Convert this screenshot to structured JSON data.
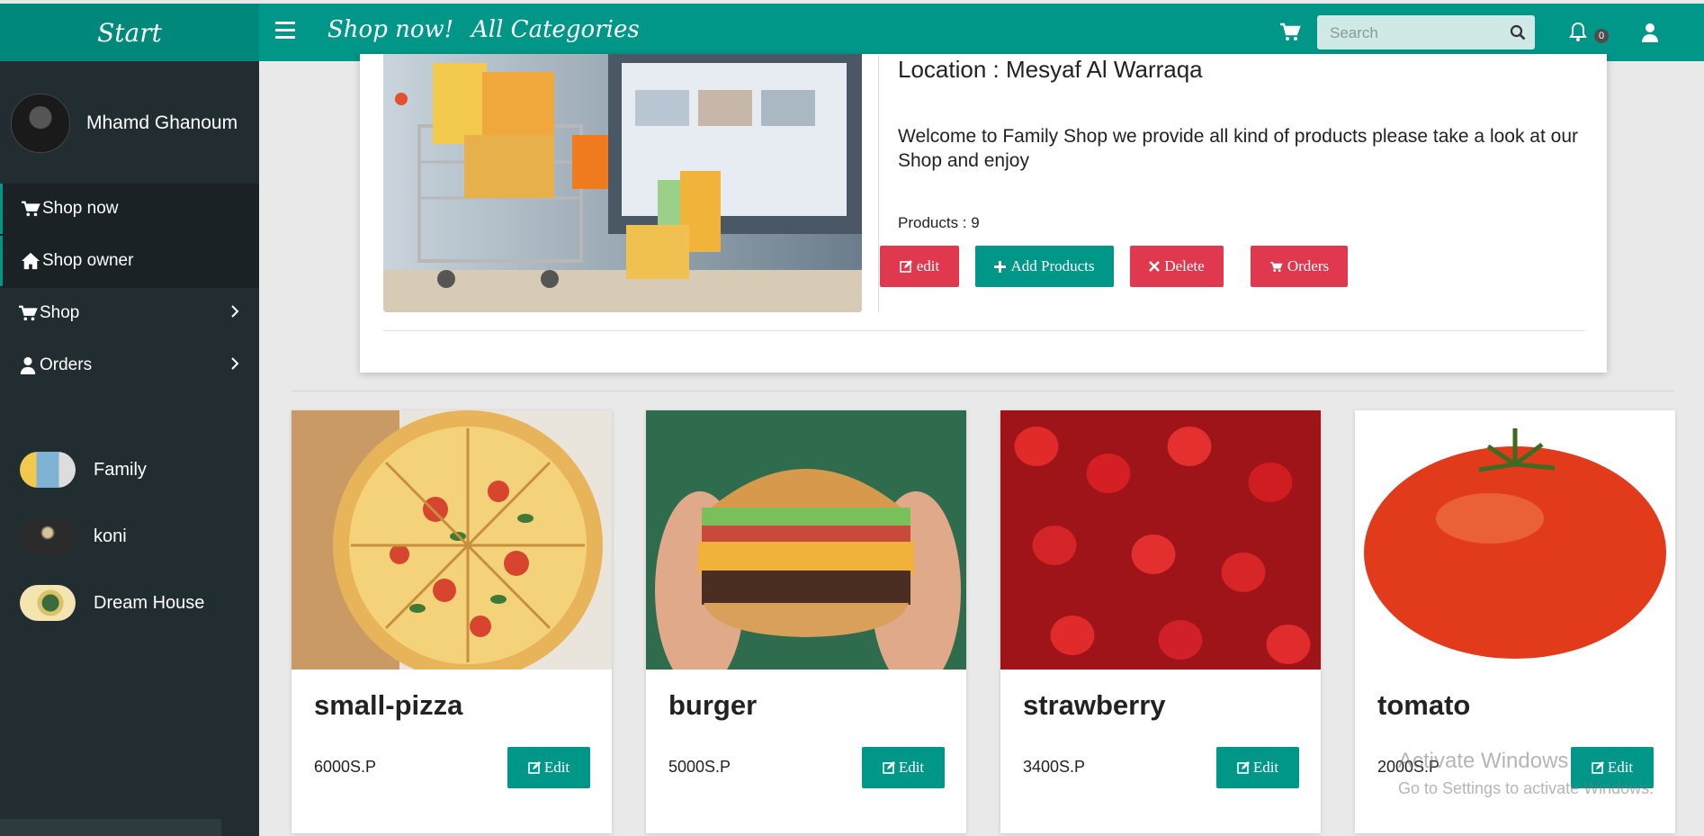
{
  "header": {
    "brand": "Start",
    "nav": [
      "Shop now!",
      "All Categories"
    ],
    "search_placeholder": "Search",
    "notification_count": "0"
  },
  "sidebar": {
    "user_name": "Mhamd Ghanoum",
    "menu": [
      {
        "label": "Shop now",
        "icon": "cart-icon"
      },
      {
        "label": "Shop owner",
        "icon": "home-icon"
      },
      {
        "label": "Shop",
        "icon": "cart-icon"
      },
      {
        "label": "Orders",
        "icon": "user-icon"
      }
    ],
    "shops": [
      "Family",
      "koni",
      "Dream House"
    ]
  },
  "shop": {
    "location": "Location : Mesyaf Al Warraqa",
    "welcome": "Welcome to Family Shop we provide all kind of products please take a look at our Shop and enjoy",
    "products_count": "Products : 9",
    "buttons": {
      "edit": "edit",
      "add": "Add Products",
      "delete": "Delete",
      "orders": "Orders"
    }
  },
  "products": [
    {
      "name": "small-pizza",
      "price": "6000S.P",
      "edit": "Edit"
    },
    {
      "name": "burger",
      "price": "5000S.P",
      "edit": "Edit"
    },
    {
      "name": "strawberry",
      "price": "3400S.P",
      "edit": "Edit"
    },
    {
      "name": "tomato",
      "price": "2000S.P",
      "edit": "Edit"
    }
  ],
  "watermark": {
    "line1": "Activate Windows",
    "line2": "Go to Settings to activate Windows."
  },
  "colors": {
    "primary": "#009688",
    "sidebar": "#222d32",
    "danger": "#e0394f"
  }
}
